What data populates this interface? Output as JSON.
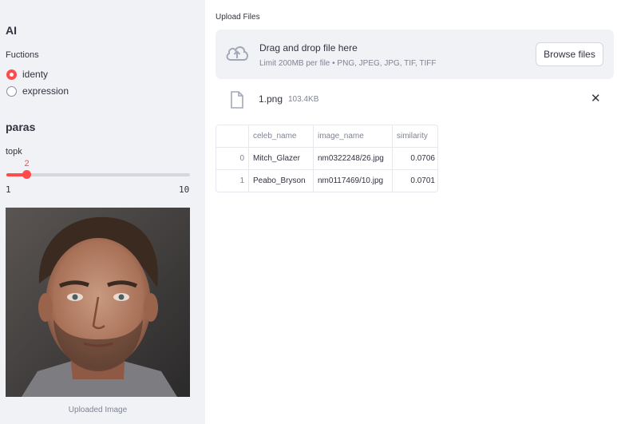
{
  "sidebar": {
    "title": "AI",
    "functions_label": "Fuctions",
    "function_options": [
      {
        "label": "identy",
        "selected": true
      },
      {
        "label": "expression",
        "selected": false
      }
    ],
    "params_title": "paras",
    "topk_label": "topk",
    "topk": {
      "value": "2",
      "min": "1",
      "max": "10"
    },
    "image_caption": "Uploaded Image"
  },
  "main": {
    "upload_label": "Upload Files",
    "dropzone": {
      "title": "Drag and drop file here",
      "subtitle": "Limit 200MB per file • PNG, JPEG, JPG, TIF, TIFF",
      "browse_label": "Browse files"
    },
    "file": {
      "name": "1.png",
      "size": "103.4KB"
    },
    "table": {
      "columns": [
        "",
        "celeb_name",
        "image_name",
        "similarity"
      ],
      "rows": [
        [
          "0",
          "Mitch_Glazer",
          "nm0322248/26.jpg",
          "0.0706"
        ],
        [
          "1",
          "Peabo_Bryson",
          "nm0117469/10.jpg",
          "0.0701"
        ]
      ]
    }
  },
  "colors": {
    "accent": "#ff4b4b",
    "sidebar_bg": "#f0f2f6",
    "text": "#31333f",
    "muted": "#808495"
  },
  "icons": {
    "upload": "cloud-upload-icon",
    "file": "file-icon",
    "close": "close-icon"
  }
}
